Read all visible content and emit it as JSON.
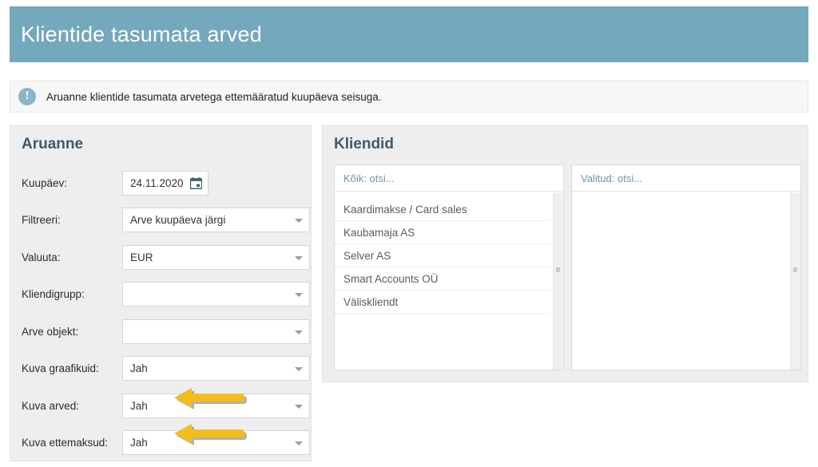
{
  "header": {
    "title": "Klientide tasumata arved",
    "bg_color": "#74a8bd"
  },
  "info": {
    "icon": "exclamation-circle-icon",
    "glyph": "!",
    "text": "Aruanne klientide tasumata arvetega ettemääratud kuupäeva seisuga."
  },
  "report_panel": {
    "heading": "Aruanne",
    "fields": [
      {
        "label": "Kuupäev:",
        "value": "24.11.2020",
        "type": "date",
        "icon": "calendar-icon"
      },
      {
        "label": "Filtreeri:",
        "value": "Arve kuupäeva järgi",
        "type": "select"
      },
      {
        "label": "Valuuta:",
        "value": "EUR",
        "type": "select"
      },
      {
        "label": "Kliendigrupp:",
        "value": "",
        "type": "select"
      },
      {
        "label": "Arve objekt:",
        "value": "",
        "type": "select"
      },
      {
        "label": "Kuva graafikuid:",
        "value": "Jah",
        "type": "select"
      },
      {
        "label": "Kuva arved:",
        "value": "Jah",
        "type": "select"
      },
      {
        "label": "Kuva ettemaksud:",
        "value": "Jah",
        "type": "select"
      }
    ]
  },
  "clients_panel": {
    "heading": "Kliendid",
    "available": {
      "search_placeholder": "Kõik: otsi...",
      "items": [
        "Kaardimakse / Card sales",
        "Kaubamaja AS",
        "Selver AS",
        "Smart Accounts OÜ",
        "Väliskliendt"
      ]
    },
    "selected": {
      "search_placeholder": "Valitud: otsi...",
      "items": []
    }
  },
  "annotations": {
    "color": "#f5bd1b",
    "arrows": [
      {
        "name": "arrow-kuva-arved",
        "points_to": "Kuva arved:"
      },
      {
        "name": "arrow-kuva-ettemaksud",
        "points_to": "Kuva ettemaksud:"
      }
    ]
  }
}
